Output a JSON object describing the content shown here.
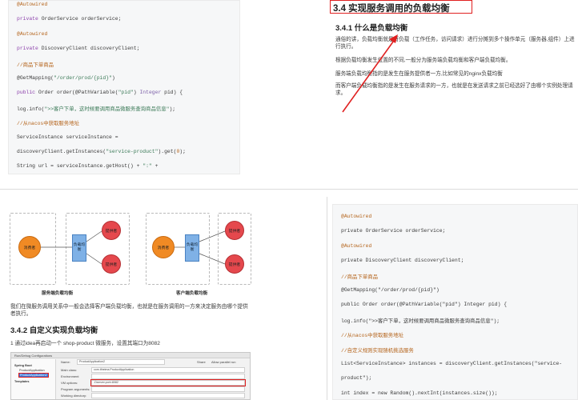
{
  "top_left_code": {
    "lines": [
      [
        {
          "t": "@Autowired",
          "c": "cm"
        }
      ],
      [
        {
          "t": "private ",
          "c": "kw"
        },
        {
          "t": "OrderService orderService;",
          "c": "fn"
        }
      ],
      [
        {
          "t": "@Autowired",
          "c": "cm"
        }
      ],
      [
        {
          "t": "private ",
          "c": "kw"
        },
        {
          "t": "DiscoveryClient discoveryClient;",
          "c": "fn"
        }
      ],
      [
        {
          "t": "//商品下单商品",
          "c": "cm"
        }
      ],
      [
        {
          "t": "@GetMapping(",
          "c": "fn"
        },
        {
          "t": "\"/order/prod/{pid}\"",
          "c": "st"
        },
        {
          "t": ")",
          "c": "fn"
        }
      ],
      [
        {
          "t": "public ",
          "c": "kw"
        },
        {
          "t": "Order order(@PathVariable(",
          "c": "fn"
        },
        {
          "t": "\"pid\"",
          "c": "st"
        },
        {
          "t": ") ",
          "c": "fn"
        },
        {
          "t": "Integer",
          "c": "ty"
        },
        {
          "t": " pid) {",
          "c": "fn"
        }
      ],
      [
        {
          "t": "log.info(",
          "c": "fn"
        },
        {
          "t": "\">>客户下单，这时候要调用商品微服务查询商品信息\"",
          "c": "st"
        },
        {
          "t": ");",
          "c": "fn"
        }
      ],
      [
        {
          "t": "//从nacos中获取服务地址",
          "c": "cm"
        }
      ],
      [
        {
          "t": "ServiceInstance serviceInstance =",
          "c": "fn"
        }
      ],
      [
        {
          "t": "discoveryClient.getInstances(",
          "c": "fn"
        },
        {
          "t": "\"service-product\"",
          "c": "st"
        },
        {
          "t": ").get(",
          "c": "fn"
        },
        {
          "t": "0",
          "c": "nm"
        },
        {
          "t": ");",
          "c": "fn"
        }
      ],
      [
        {
          "t": "String url = serviceInstance.getHost() + ",
          "c": "fn"
        },
        {
          "t": "\":\"",
          "c": "st"
        },
        {
          "t": " +",
          "c": "fn"
        }
      ]
    ]
  },
  "top_right": {
    "heading": "3.4 实现服务调用的负载均衡",
    "subheading": "3.4.1 什么是负载均衡",
    "paragraphs": [
      "通俗的讲，负载均衡就是将负载（工作任务，访问请求）进行分摊到多个操作单元（服务器,组件）上进行执行。",
      "根据负载均衡发生位置的不同,一般分为服务端负载均衡和客户端负载均衡。",
      "服务端负载均衡指的是发生在服务提供者一方,比如常见的nginx负载均衡",
      "而客户端负载均衡指的是发生在服务请求的一方，也就是在发送请求之前已经选好了由哪个实例处理请求。"
    ]
  },
  "diagram": {
    "left": {
      "consumer": "消费者",
      "lb": "负载均衡",
      "providers": [
        "提供者",
        "提供者"
      ],
      "caption": "服务端负载均衡"
    },
    "right": {
      "consumer": "消费者",
      "lb": "负载均衡",
      "providers": [
        "提供者",
        "提供者"
      ],
      "caption": "客户端负载均衡"
    }
  },
  "bottom_left": {
    "paragraph": "我们在微服务调用关系中一般会选择客户端负载均衡，也就是在服务调用的一方来决定服务由哪个提供者执行。",
    "subheading": "3.4.2 自定义实现负载均衡",
    "step": "1 通过idea再启动一个 shop-product 微服务，设置其端口为8082",
    "ide": {
      "title": "Run/Debug Configurations",
      "name_label": "Name:",
      "name_value": "ProductApplication2",
      "share_label": "Share",
      "parallel_label": "Allow parallel run",
      "tree": [
        "Spring Boot",
        "ProductApplication",
        "ProductApplication2",
        "Templates"
      ],
      "fields": [
        {
          "label": "Main class:",
          "value": "com.itheima.ProductApplication"
        },
        {
          "label": "Environment",
          "value": ""
        },
        {
          "label": "VM options:",
          "value": "-Dserver.port=8082"
        },
        {
          "label": "Program arguments:",
          "value": ""
        },
        {
          "label": "Working directory:",
          "value": ""
        }
      ]
    }
  },
  "bottom_right_code": {
    "lines": [
      [
        {
          "t": "@Autowired",
          "c": "cm"
        }
      ],
      [
        {
          "t": "private OrderService orderService;",
          "c": "fn"
        }
      ],
      [
        {
          "t": "@Autowired",
          "c": "cm"
        }
      ],
      [
        {
          "t": "private DiscoveryClient discoveryClient;",
          "c": "fn"
        }
      ],
      [
        {
          "t": "//商品下单商品",
          "c": "cm"
        }
      ],
      [
        {
          "t": "@GetMapping(\"/order/prod/{pid}\")",
          "c": "fn"
        }
      ],
      [
        {
          "t": "public Order order(@PathVariable(\"pid\") Integer pid) {",
          "c": "fn"
        }
      ],
      [
        {
          "t": "log.info(\">>客户下单，这时候要调用商品微服务查询商品信息\");",
          "c": "fn"
        }
      ],
      [
        {
          "t": "//从nacos中获取服务地址",
          "c": "cm"
        }
      ],
      [
        {
          "t": "//自定义规则实现随机挑选服务",
          "c": "cm"
        }
      ],
      [
        {
          "t": "List<ServiceInstance> instances = discoveryClient.getInstances(\"service-",
          "c": "fn"
        }
      ],
      [
        {
          "t": "product\");",
          "c": "fn"
        }
      ],
      [
        {
          "t": "int index = new Random().nextInt(instances.size());",
          "c": "fn"
        }
      ]
    ]
  },
  "colors": {
    "highlight_border": "#e02020",
    "arrow": "#e02020"
  }
}
